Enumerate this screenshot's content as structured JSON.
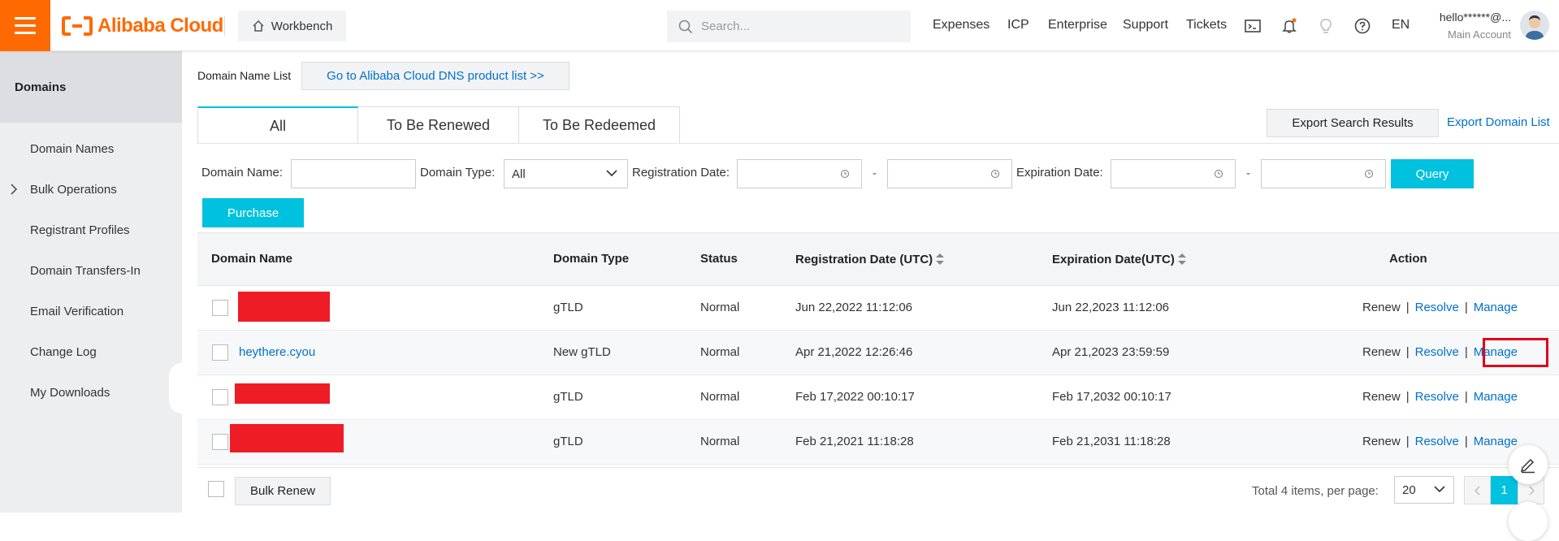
{
  "topbar": {
    "brand": "Alibaba Cloud",
    "workbench": "Workbench",
    "search_placeholder": "Search...",
    "nav": [
      "Expenses",
      "ICP",
      "Enterprise",
      "Support",
      "Tickets"
    ],
    "lang": "EN",
    "user": "hello******@...",
    "account_type": "Main Account",
    "icons": [
      "terminal-icon",
      "bell-icon",
      "lightbulb-icon",
      "help-icon"
    ],
    "brand_color": "#ff6a00"
  },
  "sidebar": {
    "title": "Domains",
    "items": [
      "Domain Names",
      "Bulk Operations",
      "Registrant Profiles",
      "Domain Transfers-In",
      "Email Verification",
      "Change Log",
      "My Downloads"
    ]
  },
  "main": {
    "list_label": "Domain Name List",
    "dns_link": "Go to Alibaba Cloud DNS product list >>",
    "tabs": [
      "All",
      "To Be Renewed",
      "To Be Redeemed"
    ],
    "export_button": "Export Search Results",
    "export_link": "Export Domain List",
    "filters": {
      "domain_name_label": "Domain Name:",
      "domain_type_label": "Domain Type:",
      "domain_type_value": "All",
      "registration_date_label": "Registration Date:",
      "expiration_date_label": "Expiration Date:",
      "dash": "-",
      "query": "Query",
      "purchase": "Purchase"
    },
    "accent_color": "#00c1de",
    "table": {
      "headers": [
        "Domain Name",
        "Domain Type",
        "Status",
        "Registration Date (UTC)",
        "Expiration Date(UTC)",
        "Action"
      ],
      "rows": [
        {
          "domain": "",
          "type": "gTLD",
          "status": "Normal",
          "reg": "Jun 22,2022 11:12:06",
          "exp": "Jun 22,2023 11:12:06"
        },
        {
          "domain": "heythere.cyou",
          "type": "New gTLD",
          "status": "Normal",
          "reg": "Apr 21,2022 12:26:46",
          "exp": "Apr 21,2023 23:59:59"
        },
        {
          "domain": "",
          "type": "gTLD",
          "status": "Normal",
          "reg": "Feb 17,2022 00:10:17",
          "exp": "Feb 17,2032 00:10:17"
        },
        {
          "domain": "",
          "type": "gTLD",
          "status": "Normal",
          "reg": "Feb 21,2021 11:18:28",
          "exp": "Feb 21,2031 11:18:28"
        }
      ],
      "actions": {
        "renew": "Renew",
        "resolve": "Resolve",
        "manage": "Manage",
        "sep": "|"
      }
    },
    "footer": {
      "bulk_renew": "Bulk Renew",
      "total": "Total 4 items, per page:",
      "per_page": "20",
      "page": "1"
    }
  }
}
